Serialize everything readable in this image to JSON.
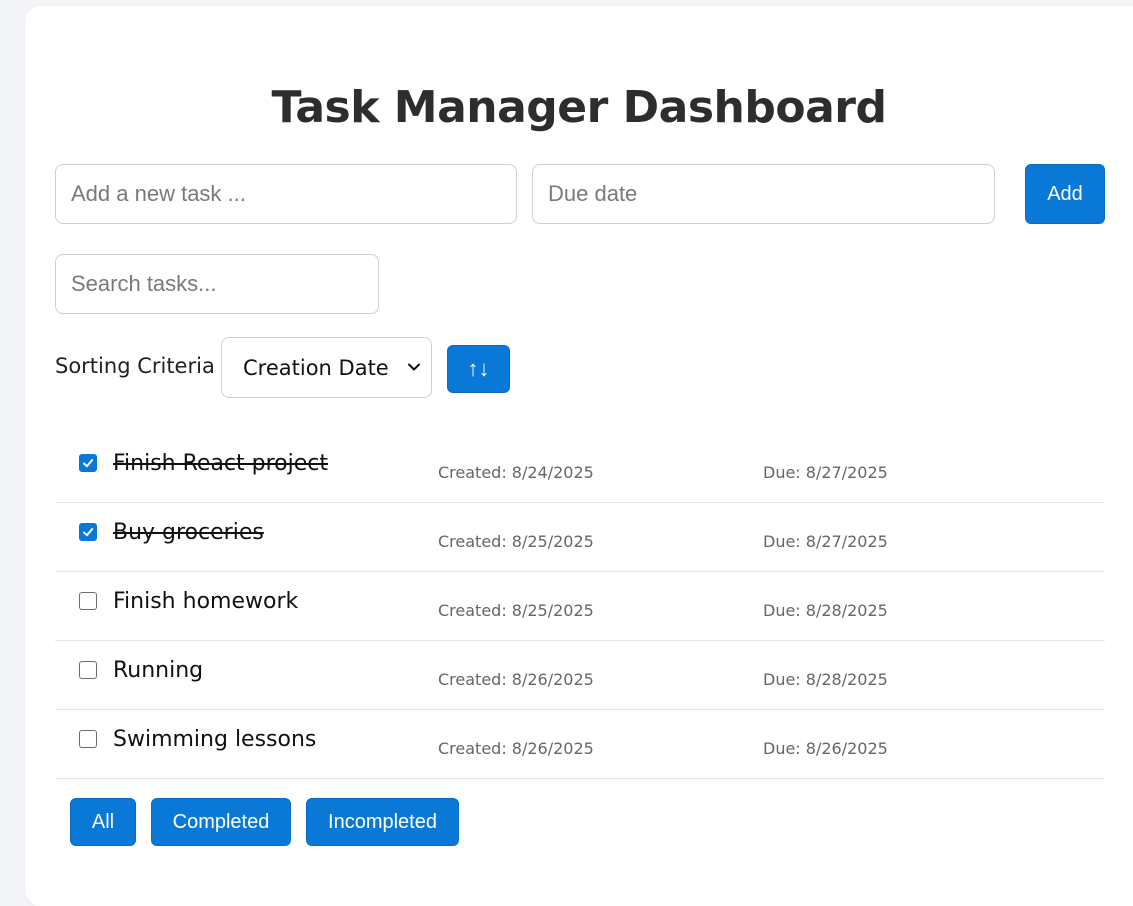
{
  "header": {
    "title": "Task Manager Dashboard"
  },
  "new_task": {
    "task_placeholder": "Add a new task ...",
    "due_placeholder": "Due date",
    "add_label": "Add"
  },
  "search": {
    "placeholder": "Search tasks..."
  },
  "sorting": {
    "label": "Sorting Criteria",
    "selected": "Creation Date",
    "toggle_label": "↑↓"
  },
  "tasks": [
    {
      "name": "Finish React project",
      "completed": true,
      "created": "Created: 8/24/2025",
      "due": "Due: 8/27/2025"
    },
    {
      "name": "Buy groceries",
      "completed": true,
      "created": "Created: 8/25/2025",
      "due": "Due: 8/27/2025"
    },
    {
      "name": "Finish homework",
      "completed": false,
      "created": "Created: 8/25/2025",
      "due": "Due: 8/28/2025"
    },
    {
      "name": "Running",
      "completed": false,
      "created": "Created: 8/26/2025",
      "due": "Due: 8/28/2025"
    },
    {
      "name": "Swimming lessons",
      "completed": false,
      "created": "Created: 8/26/2025",
      "due": "Due: 8/26/2025"
    }
  ],
  "filters": {
    "all_label": "All",
    "completed_label": "Completed",
    "incompleted_label": "Incompleted"
  },
  "colors": {
    "accent": "#0a78d6",
    "background": "#f4f5f9",
    "card": "#ffffff",
    "title_text": "#2d2d2d",
    "meta_text": "#666666"
  },
  "icons": {
    "checkbox_checked": "checkmark-icon",
    "select_chevron": "chevron-down-icon",
    "sort_toggle": "sort-arrows-icon"
  }
}
